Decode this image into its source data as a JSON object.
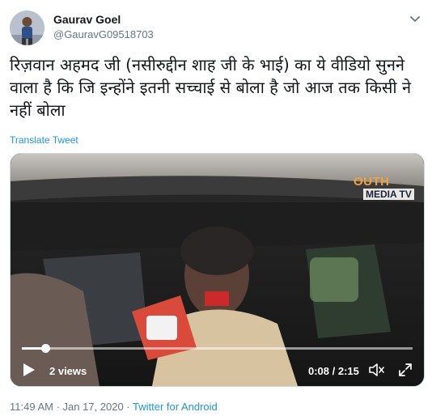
{
  "user": {
    "display_name": "Gaurav Goel",
    "handle": "@GauravG09518703"
  },
  "tweet": {
    "text": "रिज़वान अहमद जी (नसीरुद्दीन शाह जी के भाई) का ये वीडियो सुनने वाला है कि जि इन्होंने इतनी सच्चाई से बोला है जो आज तक किसी ने नहीं बोला",
    "translate_label": "Translate Tweet"
  },
  "video": {
    "channel_logo_line1": "OUTH",
    "channel_logo_line2": "MEDIA TV",
    "views": "2 views",
    "time": "0:08 / 2:15",
    "progress": 0.06
  },
  "footer": {
    "timestamp": "11:49 AM · Jan 17, 2020 · ",
    "source": "Twitter for Android"
  },
  "colors": {
    "link": "#1b95e0",
    "secondary_text": "#657786",
    "primary_text": "#14171a"
  },
  "icons": [
    "chevron-down-icon",
    "play-icon",
    "volume-icon",
    "fullscreen-icon"
  ]
}
